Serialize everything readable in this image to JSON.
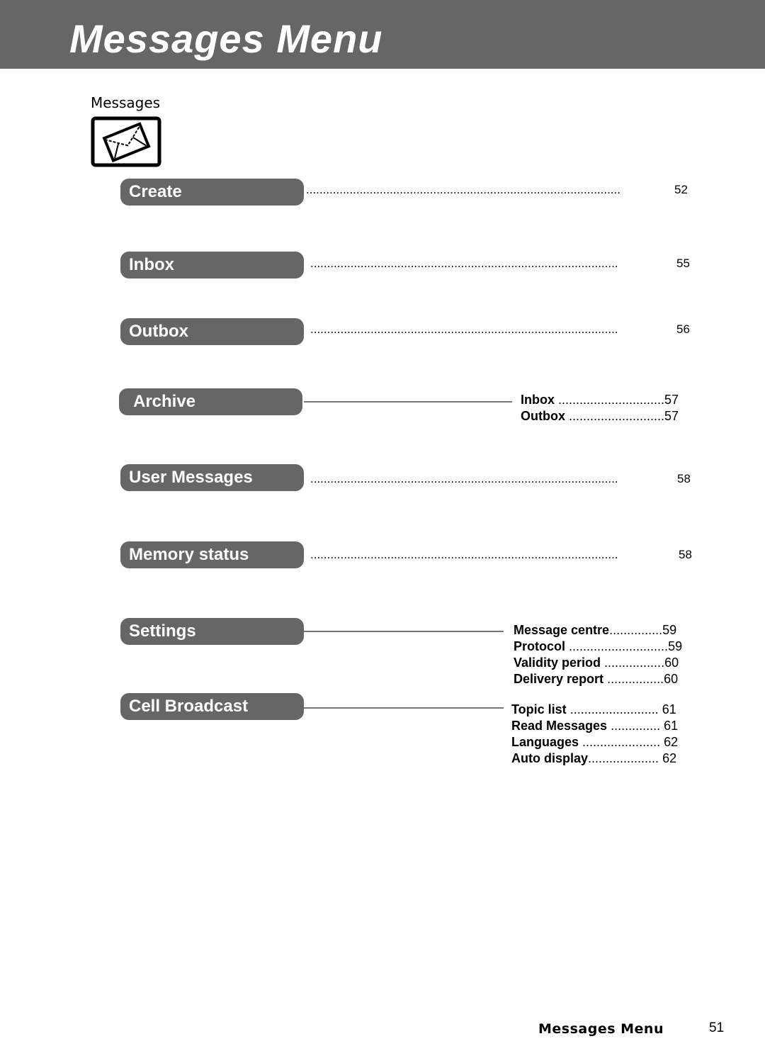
{
  "header": {
    "title": "Messages Menu"
  },
  "section": {
    "label": "Messages",
    "icon": "envelope-icon"
  },
  "menu": [
    {
      "label": "Create",
      "dots": "..............................................................................................",
      "page": "52"
    },
    {
      "label": "Inbox",
      "dots": "............................................................................................",
      "page": "55"
    },
    {
      "label": "Outbox",
      "dots": "............................................................................................",
      "page": "56"
    },
    {
      "label": "Archive",
      "subitems": [
        {
          "label": "Inbox",
          "dots": "..............................",
          "page": "57"
        },
        {
          "label": "Outbox",
          "dots": "...........................",
          "page": "57"
        }
      ]
    },
    {
      "label": "User Messages",
      "dots": "............................................................................................",
      "page": "58"
    },
    {
      "label": "Memory status",
      "dots": "............................................................................................",
      "page": "58"
    },
    {
      "label": "Settings",
      "subitems": [
        {
          "label": "Message centre",
          "dots": "...............",
          "page": "59"
        },
        {
          "label": "Protocol",
          "dots": "............................",
          "page": "59"
        },
        {
          "label": "Validity period",
          "dots": ".................",
          "page": "60"
        },
        {
          "label": "Delivery report",
          "dots": "................",
          "page": "60"
        }
      ]
    },
    {
      "label": "Cell Broadcast",
      "subitems": [
        {
          "label": "Topic list",
          "dots": ".........................",
          "page": "61"
        },
        {
          "label": "Read Messages",
          "dots": "..............",
          "page": "61"
        },
        {
          "label": "Languages",
          "dots": "......................",
          "page": "62"
        },
        {
          "label": "Auto display",
          "dots": "....................",
          "page": "62"
        }
      ]
    }
  ],
  "footer": {
    "title": "Messages Menu",
    "page": "51"
  }
}
